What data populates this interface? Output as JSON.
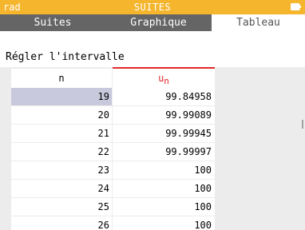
{
  "status_bar": {
    "mode": "rad",
    "title": "SUITES",
    "color": "#f5b52d"
  },
  "tabs": [
    {
      "label": "Suites",
      "active": false
    },
    {
      "label": "Graphique",
      "active": false
    },
    {
      "label": "Tableau",
      "active": true
    }
  ],
  "interval_button": {
    "label": "Régler l'intervalle"
  },
  "table": {
    "columns": {
      "n": "n",
      "u_base": "u",
      "u_sub": "n"
    },
    "rows": [
      {
        "n": "19",
        "u": "99.84958",
        "selected": true
      },
      {
        "n": "20",
        "u": "99.99089",
        "selected": false
      },
      {
        "n": "21",
        "u": "99.99945",
        "selected": false
      },
      {
        "n": "22",
        "u": "99.99997",
        "selected": false
      },
      {
        "n": "23",
        "u": "100",
        "selected": false
      },
      {
        "n": "24",
        "u": "100",
        "selected": false
      },
      {
        "n": "25",
        "u": "100",
        "selected": false
      },
      {
        "n": "26",
        "u": "100",
        "selected": false
      }
    ]
  },
  "icons": {
    "battery": "battery-icon"
  },
  "colors": {
    "accent": "#e0282a",
    "tab_bg": "#656565",
    "selection": "#c9c9dd"
  }
}
